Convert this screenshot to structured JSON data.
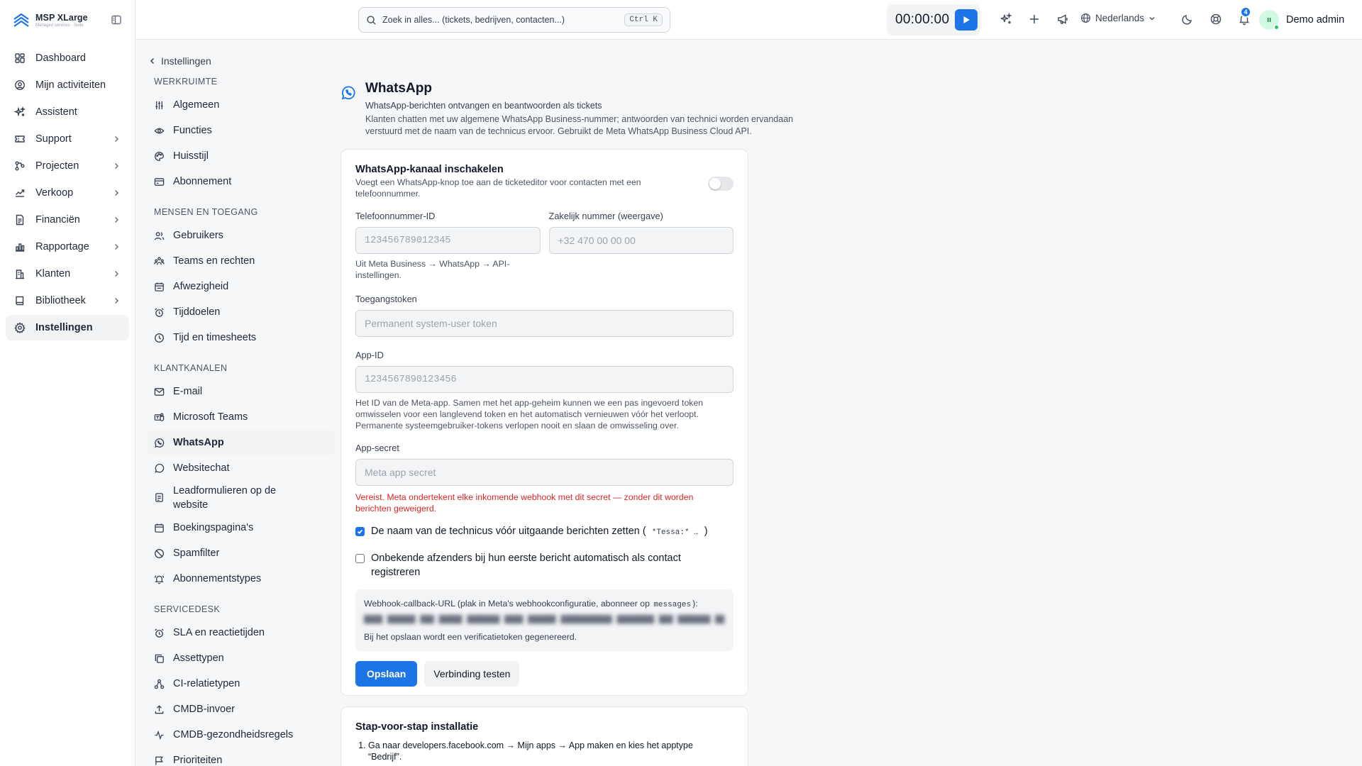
{
  "brand": {
    "name": "MSP XLarge",
    "sub": "Managed services · Suite"
  },
  "sidebar": {
    "items": [
      {
        "label": "Dashboard",
        "icon": "dashboard-icon"
      },
      {
        "label": "Mijn activiteiten",
        "icon": "user-circle-icon"
      },
      {
        "label": "Assistent",
        "icon": "sparkles-icon"
      },
      {
        "label": "Support",
        "icon": "ticket-icon"
      },
      {
        "label": "Projecten",
        "icon": "kanban-icon"
      },
      {
        "label": "Verkoop",
        "icon": "trend-icon"
      },
      {
        "label": "Financiën",
        "icon": "receipt-icon"
      },
      {
        "label": "Rapportage",
        "icon": "chart-icon"
      },
      {
        "label": "Klanten",
        "icon": "building-icon"
      },
      {
        "label": "Bibliotheek",
        "icon": "book-icon"
      },
      {
        "label": "Instellingen",
        "icon": "gear-icon"
      }
    ]
  },
  "topbar": {
    "search_placeholder": "Zoek in alles... (tickets, bedrijven, contacten...)",
    "search_shortcut": "Ctrl K",
    "timer": "00:00:00",
    "language": "Nederlands",
    "notifications_count": "4",
    "user_name": "Demo admin"
  },
  "settings_nav": {
    "back_label": "Instellingen",
    "sections": {
      "werkruimte": {
        "title": "WERKRUIMTE",
        "items": [
          "Algemeen",
          "Functies",
          "Huisstijl",
          "Abonnement"
        ]
      },
      "mensen": {
        "title": "MENSEN EN TOEGANG",
        "items": [
          "Gebruikers",
          "Teams en rechten",
          "Afwezigheid",
          "Tijddoelen",
          "Tijd en timesheets"
        ]
      },
      "kanalen": {
        "title": "KLANTKANALEN",
        "items": [
          "E-mail",
          "Microsoft Teams",
          "WhatsApp",
          "Websitechat",
          "Leadformulieren op de website",
          "Boekingspagina's",
          "Spamfilter",
          "Abonnementstypes"
        ]
      },
      "servicedesk": {
        "title": "SERVICEDESK",
        "items": [
          "SLA en reactietijden",
          "Assettypen",
          "CI-relatietypen",
          "CMDB-invoer",
          "CMDB-gezondheidsregels",
          "Prioriteiten"
        ]
      }
    }
  },
  "page": {
    "title": "WhatsApp",
    "subtitle": "WhatsApp-berichten ontvangen en beantwoorden als tickets",
    "description": "Klanten chatten met uw algemene WhatsApp Business-nummer; antwoorden van technici worden ervandaan verstuurd met de naam van de technicus ervoor. Gebruikt de Meta WhatsApp Business Cloud API."
  },
  "form": {
    "enable_label": "WhatsApp-kanaal inschakelen",
    "enable_help": "Voegt een WhatsApp-knop toe aan de ticketeditor voor contacten met een telefoonnummer.",
    "enabled": false,
    "phone_id_label": "Telefoonnummer-ID",
    "phone_id_placeholder": "123456789012345",
    "phone_id_help": "Uit Meta Business → WhatsApp → API-instellingen.",
    "business_number_label": "Zakelijk nummer (weergave)",
    "business_number_placeholder": "+32 470 00 00 00",
    "token_label": "Toegangstoken",
    "token_placeholder": "Permanent system-user token",
    "app_id_label": "App-ID",
    "app_id_placeholder": "1234567890123456",
    "app_id_help": "Het ID van de Meta-app. Samen met het app-geheim kunnen we een pas ingevoerd token omwisselen voor een langlevend token en het automatisch vernieuwen vóór het verloopt. Permanente systeemgebruiker-tokens verlopen nooit en slaan de omwisseling over.",
    "app_secret_label": "App-secret",
    "app_secret_placeholder": "Meta app secret",
    "app_secret_error": "Vereist. Meta ondertekent elke inkomende webhook met dit secret — zonder dit worden berichten geweigerd.",
    "prefix_label_before": "De naam van de technicus vóór uitgaande berichten zetten (",
    "prefix_code": "*Tessa:* …",
    "prefix_label_after": ")",
    "prefix_checked": true,
    "autoregister_label": "Onbekende afzenders bij hun eerste bericht automatisch als contact registreren",
    "autoregister_checked": false,
    "webhook_label_before": "Webhook-callback-URL (plak in Meta's webhookconfiguratie, abonneer op",
    "webhook_label_code": "messages",
    "webhook_label_after": "):",
    "webhook_note": "Bij het opslaan wordt een verificatietoken gegenereerd.",
    "save_label": "Opslaan",
    "test_label": "Verbinding testen"
  },
  "steps": {
    "title": "Stap-voor-stap installatie",
    "items": [
      "Ga naar developers.facebook.com → Mijn apps → App maken en kies het apptype “Bedrijf”."
    ]
  },
  "colors": {
    "accent": "#1d74e7",
    "error": "#dc2626",
    "active_bg": "#f1f3f5"
  }
}
